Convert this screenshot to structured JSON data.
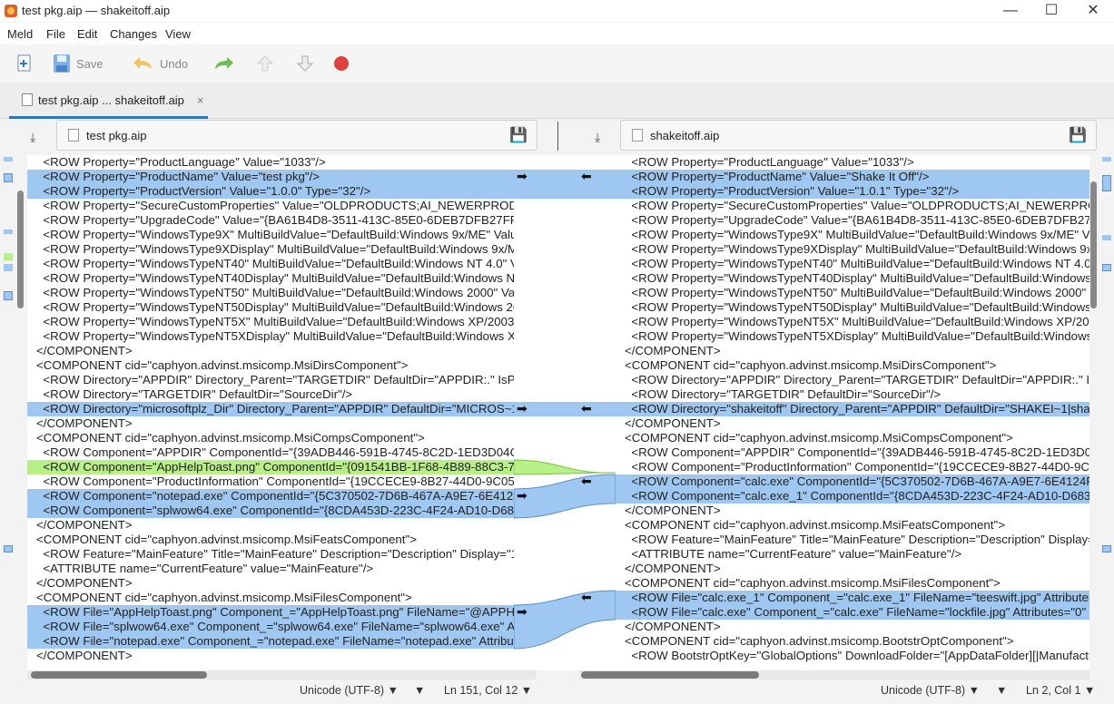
{
  "window": {
    "title": "test pkg.aip — shakeitoff.aip",
    "minimize": "—",
    "maximize": "☐",
    "close": "✕"
  },
  "menu": [
    "Meld",
    "File",
    "Edit",
    "Changes",
    "View"
  ],
  "toolbar": {
    "save_label": "Save",
    "undo_label": "Undo"
  },
  "tab": {
    "label": "test pkg.aip ... shakeitoff.aip",
    "close": "×"
  },
  "files": {
    "left": "test pkg.aip",
    "right": "shakeitoff.aip"
  },
  "left_lines": [
    "  <ROW Property=\"ProductLanguage\" Value=\"1033\"/>",
    "  <ROW Property=\"ProductName\" Value=\"test pkg\"/>",
    "  <ROW Property=\"ProductVersion\" Value=\"1.0.0\" Type=\"32\"/>",
    "  <ROW Property=\"SecureCustomProperties\" Value=\"OLDPRODUCTS;AI_NEWERPRODUCT",
    "  <ROW Property=\"UpgradeCode\" Value=\"{BA61B4D8-3511-413C-85E0-6DEB7DFB27FF}\"/",
    "  <ROW Property=\"WindowsType9X\" MultiBuildValue=\"DefaultBuild:Windows 9x/ME\" Value",
    "  <ROW Property=\"WindowsType9XDisplay\" MultiBuildValue=\"DefaultBuild:Windows 9x/ME",
    "  <ROW Property=\"WindowsTypeNT40\" MultiBuildValue=\"DefaultBuild:Windows NT 4.0\" Va",
    "  <ROW Property=\"WindowsTypeNT40Display\" MultiBuildValue=\"DefaultBuild:Windows NT",
    "  <ROW Property=\"WindowsTypeNT50\" MultiBuildValue=\"DefaultBuild:Windows 2000\" Valu",
    "  <ROW Property=\"WindowsTypeNT50Display\" MultiBuildValue=\"DefaultBuild:Windows 20",
    "  <ROW Property=\"WindowsTypeNT5X\" MultiBuildValue=\"DefaultBuild:Windows XP/2003\"",
    "  <ROW Property=\"WindowsTypeNT5XDisplay\" MultiBuildValue=\"DefaultBuild:Windows XP",
    "</COMPONENT>",
    "<COMPONENT cid=\"caphyon.advinst.msicomp.MsiDirsComponent\">",
    "  <ROW Directory=\"APPDIR\" Directory_Parent=\"TARGETDIR\" DefaultDir=\"APPDIR:.\" IsPse",
    "  <ROW Directory=\"TARGETDIR\" DefaultDir=\"SourceDir\"/>",
    "  <ROW Directory=\"microsoftplz_Dir\" Directory_Parent=\"APPDIR\" DefaultDir=\"MICROS~1",
    "</COMPONENT>",
    "<COMPONENT cid=\"caphyon.advinst.msicomp.MsiCompsComponent\">",
    "  <ROW Component=\"APPDIR\" ComponentId=\"{39ADB446-591B-4745-8C2D-1ED3D04C7D",
    "  <ROW Component=\"AppHelpToast.png\" ComponentId=\"{091541BB-1F68-4B89-88C3-731",
    "  <ROW Component=\"ProductInformation\" ComponentId=\"{19CCECE9-8B27-44D0-9C05-9(",
    "  <ROW Component=\"notepad.exe\" ComponentId=\"{5C370502-7D6B-467A-A9E7-6E4124F",
    "  <ROW Component=\"splwow64.exe\" ComponentId=\"{8CDA453D-223C-4F24-AD10-D6836",
    "</COMPONENT>",
    "<COMPONENT cid=\"caphyon.advinst.msicomp.MsiFeatsComponent\">",
    "  <ROW Feature=\"MainFeature\" Title=\"MainFeature\" Description=\"Description\" Display=\"1",
    "  <ATTRIBUTE name=\"CurrentFeature\" value=\"MainFeature\"/>",
    "</COMPONENT>",
    "<COMPONENT cid=\"caphyon.advinst.msicomp.MsiFilesComponent\">",
    "  <ROW File=\"AppHelpToast.png\" Component_=\"AppHelpToast.png\" FileName=\"@APPHE",
    "  <ROW File=\"splwow64.exe\" Component_=\"splwow64.exe\" FileName=\"splwow64.exe\" At",
    "  <ROW File=\"notepad.exe\" Component_=\"notepad.exe\" FileName=\"notepad.exe\" Attribut",
    "</COMPONENT>"
  ],
  "right_lines": [
    "  <ROW Property=\"ProductLanguage\" Value=\"1033\"/>",
    "  <ROW Property=\"ProductName\" Value=\"Shake It Off\"/>",
    "  <ROW Property=\"ProductVersion\" Value=\"1.0.1\" Type=\"32\"/>",
    "  <ROW Property=\"SecureCustomProperties\" Value=\"OLDPRODUCTS;AI_NEWERPRODUCT",
    "  <ROW Property=\"UpgradeCode\" Value=\"{BA61B4D8-3511-413C-85E0-6DEB7DFB27FF}\"/",
    "  <ROW Property=\"WindowsType9X\" MultiBuildValue=\"DefaultBuild:Windows 9x/ME\" Value",
    "  <ROW Property=\"WindowsType9XDisplay\" MultiBuildValue=\"DefaultBuild:Windows 9x/ME",
    "  <ROW Property=\"WindowsTypeNT40\" MultiBuildValue=\"DefaultBuild:Windows NT 4.0\" Va",
    "  <ROW Property=\"WindowsTypeNT40Display\" MultiBuildValue=\"DefaultBuild:Windows NT",
    "  <ROW Property=\"WindowsTypeNT50\" MultiBuildValue=\"DefaultBuild:Windows 2000\" Valu",
    "  <ROW Property=\"WindowsTypeNT50Display\" MultiBuildValue=\"DefaultBuild:Windows 20",
    "  <ROW Property=\"WindowsTypeNT5X\" MultiBuildValue=\"DefaultBuild:Windows XP/2003\"",
    "  <ROW Property=\"WindowsTypeNT5XDisplay\" MultiBuildValue=\"DefaultBuild:Windows XP",
    "</COMPONENT>",
    "<COMPONENT cid=\"caphyon.advinst.msicomp.MsiDirsComponent\">",
    "  <ROW Directory=\"APPDIR\" Directory_Parent=\"TARGETDIR\" DefaultDir=\"APPDIR:.\" IsPse",
    "  <ROW Directory=\"TARGETDIR\" DefaultDir=\"SourceDir\"/>",
    "  <ROW Directory=\"shakeitoff\" Directory_Parent=\"APPDIR\" DefaultDir=\"SHAKEI~1|shakei",
    "</COMPONENT>",
    "<COMPONENT cid=\"caphyon.advinst.msicomp.MsiCompsComponent\">",
    "  <ROW Component=\"APPDIR\" ComponentId=\"{39ADB446-591B-4745-8C2D-1ED3D04C7D",
    "  <ROW Component=\"ProductInformation\" ComponentId=\"{19CCECE9-8B27-44D0-9C05-96",
    "  <ROW Component=\"calc.exe\" ComponentId=\"{5C370502-7D6B-467A-A9E7-6E4124F0461",
    "  <ROW Component=\"calc.exe_1\" ComponentId=\"{8CDA453D-223C-4F24-AD10-D6836E28",
    "</COMPONENT>",
    "<COMPONENT cid=\"caphyon.advinst.msicomp.MsiFeatsComponent\">",
    "  <ROW Feature=\"MainFeature\" Title=\"MainFeature\" Description=\"Description\" Display=\"1",
    "  <ATTRIBUTE name=\"CurrentFeature\" value=\"MainFeature\"/>",
    "</COMPONENT>",
    "<COMPONENT cid=\"caphyon.advinst.msicomp.MsiFilesComponent\">",
    "  <ROW File=\"calc.exe_1\" Component_=\"calc.exe_1\" FileName=\"teeswift.jpg\" Attributes=\"",
    "  <ROW File=\"calc.exe\" Component_=\"calc.exe\" FileName=\"lockfile.jpg\" Attributes=\"0\" So",
    "</COMPONENT>",
    "<COMPONENT cid=\"caphyon.advinst.msicomp.BootstrOptComponent\">",
    "  <ROW BootstrOptKey=\"GlobalOptions\" DownloadFolder=\"[AppDataFolder][|Manufacturer"
  ],
  "status": {
    "left": {
      "encoding": "Unicode (UTF-8)",
      "position": "Ln 151, Col 12"
    },
    "right": {
      "encoding": "Unicode (UTF-8)",
      "position": "Ln 2, Col 1"
    }
  },
  "colors": {
    "changed": "#9ec8f2",
    "word_change": "#5ea4e8",
    "inserted": "#b8f088",
    "accent": "#2f74c0"
  },
  "icons": [
    "new-comparison-icon",
    "save-icon",
    "undo-icon",
    "redo-icon",
    "prev-change-icon",
    "next-change-icon",
    "stop-icon",
    "download-icon",
    "save-file-icon",
    "push-right-arrow-icon",
    "push-left-arrow-icon"
  ]
}
